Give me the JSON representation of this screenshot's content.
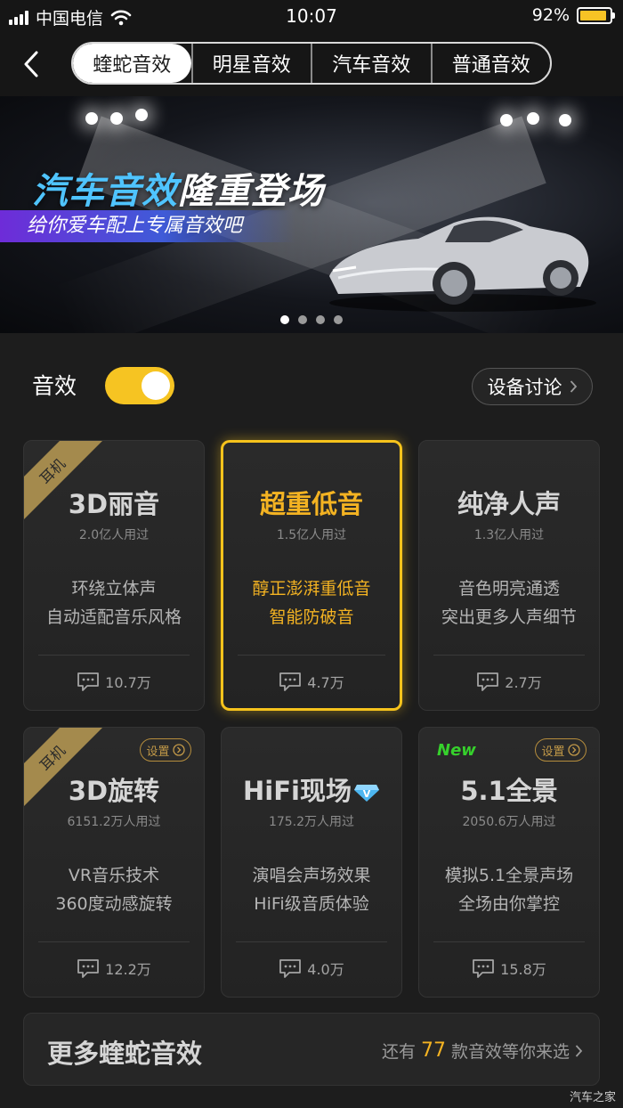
{
  "status_bar": {
    "carrier": "中国电信",
    "time": "10:07",
    "battery": "92%"
  },
  "nav": {
    "tabs": [
      {
        "label": "蝰蛇音效",
        "active": true
      },
      {
        "label": "明星音效",
        "active": false
      },
      {
        "label": "汽车音效",
        "active": false
      },
      {
        "label": "普通音效",
        "active": false
      }
    ]
  },
  "banner": {
    "title_highlight": "汽车音效",
    "title_rest": "隆重登场",
    "subtitle": "给你爱车配上专属音效吧",
    "pages": 4,
    "active_page": 1
  },
  "effects": {
    "label": "音效",
    "enabled": true,
    "device_button": "设备讨论"
  },
  "cards": [
    {
      "title": "3D丽音",
      "users": "2.0亿人用过",
      "desc1": "环绕立体声",
      "desc2": "自动适配音乐风格",
      "comments": "10.7万",
      "ribbon": "耳机"
    },
    {
      "title": "超重低音",
      "users": "1.5亿人用过",
      "desc1": "醇正澎湃重低音",
      "desc2": "智能防破音",
      "comments": "4.7万",
      "selected": true
    },
    {
      "title": "纯净人声",
      "users": "1.3亿人用过",
      "desc1": "音色明亮通透",
      "desc2": "突出更多人声细节",
      "comments": "2.7万"
    },
    {
      "title": "3D旋转",
      "users": "6151.2万人用过",
      "desc1": "VR音乐技术",
      "desc2": "360度动感旋转",
      "comments": "12.2万",
      "ribbon": "耳机",
      "settings": "设置"
    },
    {
      "title": "HiFi现场",
      "users": "175.2万人用过",
      "desc1": "演唱会声场效果",
      "desc2": "HiFi级音质体验",
      "comments": "4.0万"
    },
    {
      "title": "5.1全景",
      "users": "2050.6万人用过",
      "desc1": "模拟5.1全景声场",
      "desc2": "全场由你掌控",
      "comments": "15.8万",
      "badge": "New",
      "settings": "设置"
    }
  ],
  "more": {
    "title": "更多蝰蛇音效",
    "prefix": "还有",
    "count": "77",
    "suffix": "款音效等你来选"
  },
  "watermark": "汽车之家",
  "colors": {
    "accent": "#f6c422",
    "selected_text": "#f4b322",
    "new_badge": "#36d12c",
    "banner_sub_gradient_start": "#6e2cd8"
  }
}
